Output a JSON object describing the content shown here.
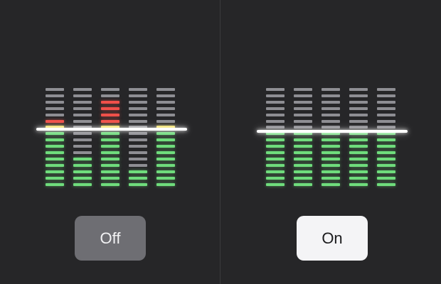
{
  "panels": [
    {
      "id": "off",
      "button_label": "Off",
      "meters": [
        {
          "level_segments": 9,
          "peak_segments": 2,
          "peak_colors": [
            "yellow",
            "red"
          ]
        },
        {
          "level_segments": 5,
          "peak_segments": 0,
          "peak_colors": []
        },
        {
          "level_segments": 9,
          "peak_segments": 5,
          "peak_colors": [
            "yellow",
            "red",
            "red",
            "red",
            "red"
          ]
        },
        {
          "level_segments": 3,
          "peak_segments": 0,
          "peak_colors": []
        },
        {
          "level_segments": 9,
          "peak_segments": 1,
          "peak_colors": [
            "yellow"
          ]
        }
      ]
    },
    {
      "id": "on",
      "button_label": "On",
      "meters": [
        {
          "level_segments": 9,
          "peak_segments": 0,
          "peak_colors": []
        },
        {
          "level_segments": 9,
          "peak_segments": 0,
          "peak_colors": []
        },
        {
          "level_segments": 9,
          "peak_segments": 0,
          "peak_colors": []
        },
        {
          "level_segments": 9,
          "peak_segments": 0,
          "peak_colors": []
        },
        {
          "level_segments": 9,
          "peak_segments": 0,
          "peak_colors": []
        }
      ]
    }
  ],
  "total_segments": 16,
  "colors": {
    "background": "#262628",
    "segment_off": "#8e8e93",
    "segment_green": "#6fdc7c",
    "segment_yellow": "#f2e05a",
    "segment_red": "#f0504a",
    "limit_line": "#ffffff",
    "button_off_bg": "#6e6e73",
    "button_on_bg": "#f4f4f6"
  }
}
